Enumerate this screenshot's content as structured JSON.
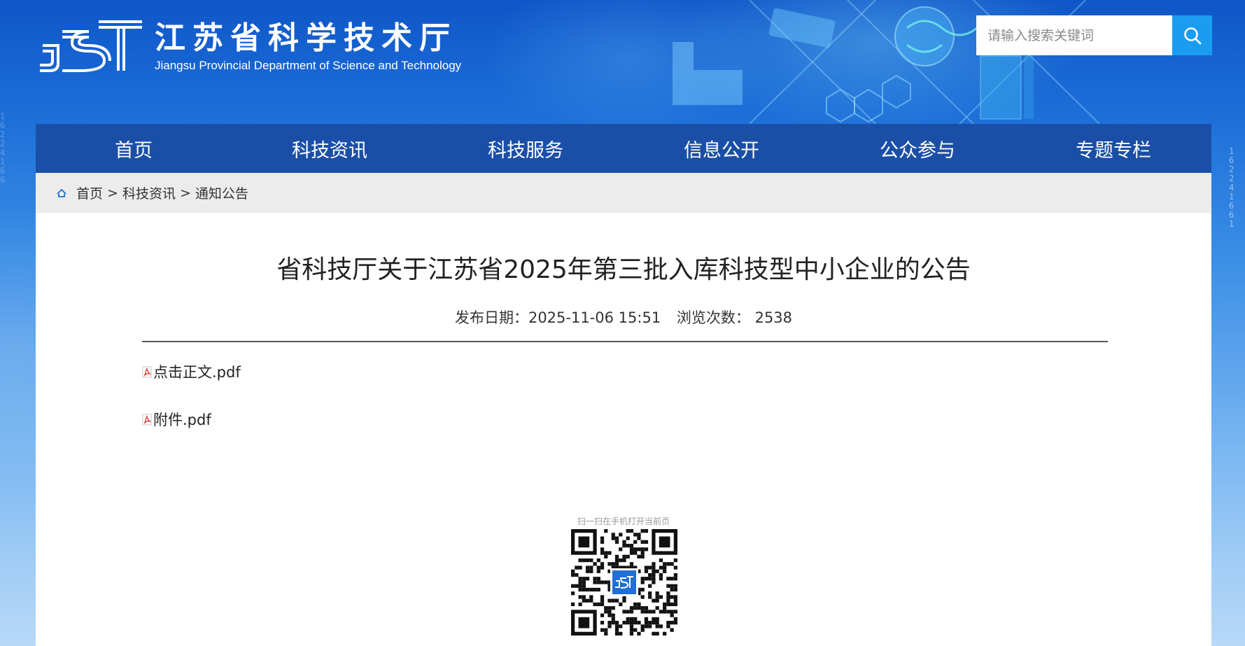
{
  "header": {
    "site_title": "江苏省科学技术厅",
    "site_subtitle": "Jiangsu Provincial Department of Science and Technology",
    "search_placeholder": "请输入搜索关键词"
  },
  "nav": {
    "items": [
      {
        "label": "首页"
      },
      {
        "label": "科技资讯"
      },
      {
        "label": "科技服务"
      },
      {
        "label": "信息公开"
      },
      {
        "label": "公众参与"
      },
      {
        "label": "专题专栏"
      }
    ]
  },
  "breadcrumb": {
    "items": [
      {
        "label": "首页"
      },
      {
        "label": "科技资讯"
      },
      {
        "label": "通知公告"
      }
    ],
    "separator": ">"
  },
  "article": {
    "title": "省科技厅关于江苏省2025年第三批入库科技型中小企业的公告",
    "publish_label": "发布日期：",
    "publish_date": "2025-11-06 15:51",
    "views_label": "浏览次数：",
    "views_count": "2538",
    "attachments": [
      {
        "name": "点击正文.pdf"
      },
      {
        "name": "附件.pdf"
      }
    ]
  },
  "qr": {
    "caption": "扫一扫在手机打开当前页"
  },
  "colors": {
    "nav_bg": "#1b4fa7",
    "search_button": "#1a9cf0",
    "breadcrumb_bg": "#ececec",
    "content_bg": "#ffffff"
  }
}
